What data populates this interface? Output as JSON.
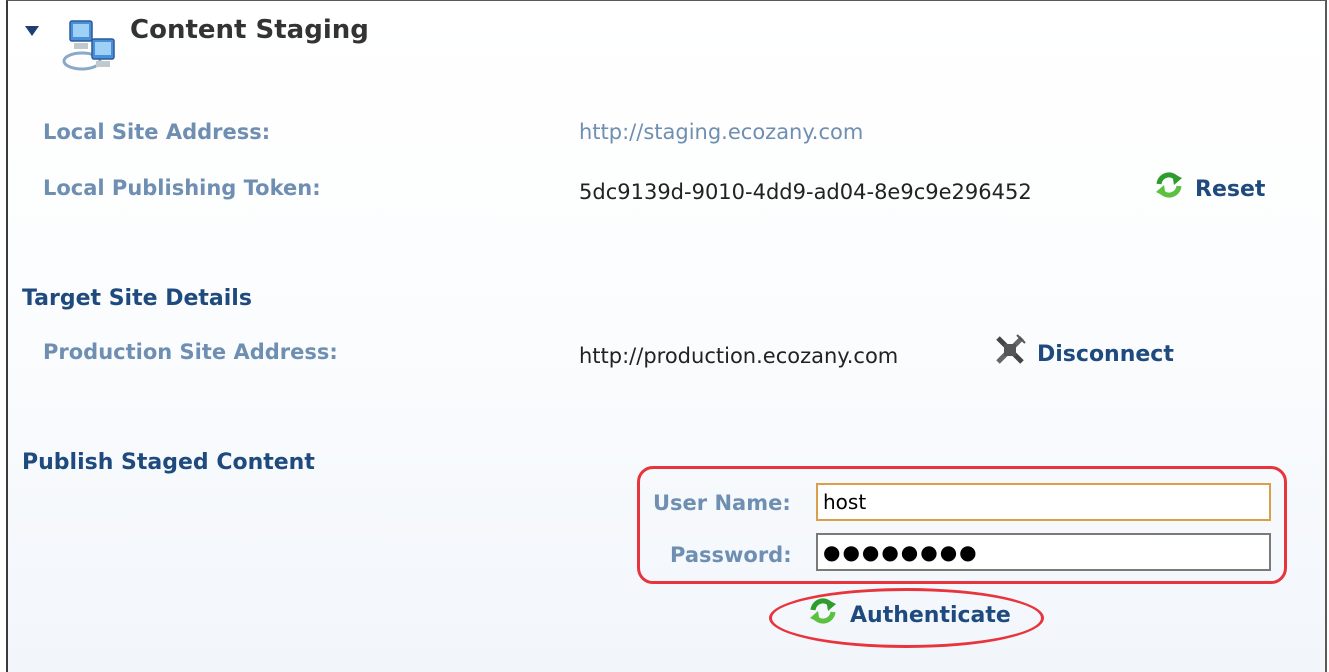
{
  "header": {
    "title": "Content Staging",
    "collapse_icon": "triangle-down-icon",
    "module_icon": "network-computers-icon"
  },
  "local": {
    "site_address_label": "Local Site Address:",
    "site_address_value": "http://staging.ecozany.com",
    "token_label": "Local Publishing Token:",
    "token_value": "5dc9139d-9010-4dd9-ad04-8e9c9e296452",
    "reset_label": "Reset",
    "reset_icon": "refresh-icon"
  },
  "target": {
    "section_title": "Target Site Details",
    "production_label": "Production Site Address:",
    "production_value": "http://production.ecozany.com",
    "disconnect_label": "Disconnect",
    "disconnect_icon": "unplug-icon"
  },
  "publish": {
    "section_title": "Publish Staged Content",
    "username_label": "User Name:",
    "username_value": "host",
    "password_label": "Password:",
    "password_value": "●●●●●●●●",
    "authenticate_label": "Authenticate",
    "authenticate_icon": "refresh-icon"
  },
  "colors": {
    "label": "#6e8fb2",
    "section_title": "#1f4a7e",
    "highlight": "#e8343c"
  }
}
